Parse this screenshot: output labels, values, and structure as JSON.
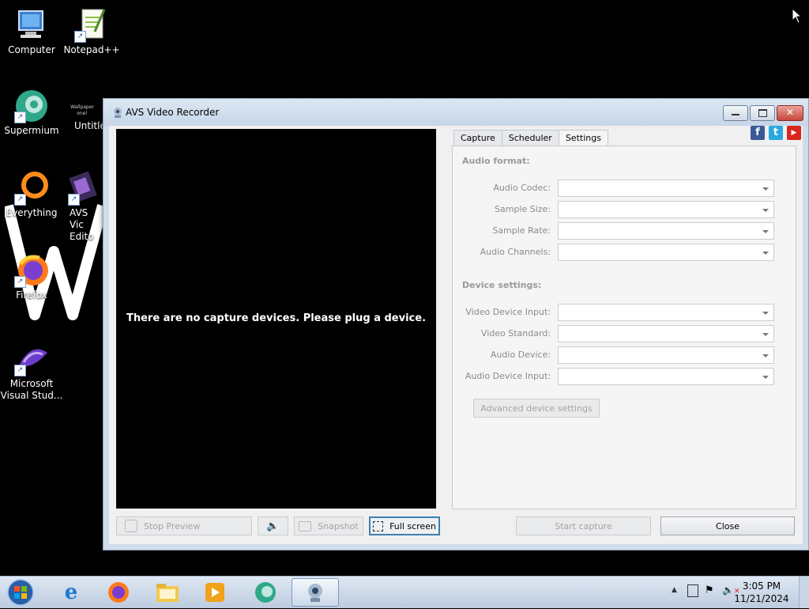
{
  "desktop": {
    "icons": [
      {
        "label": "Computer"
      },
      {
        "label": "Notepad++"
      },
      {
        "label": "Supermium"
      },
      {
        "label": "Untitle"
      },
      {
        "label": "Everything"
      },
      {
        "label": "AVS Vic Edito"
      },
      {
        "label": "Firefox"
      },
      {
        "label": "Microsoft Visual Stud..."
      }
    ],
    "wallpaper_thumb_text": "Wallpaper one!"
  },
  "window": {
    "title": "AVS Video Recorder",
    "preview_message": "There are no capture devices. Please plug a device.",
    "social": [
      "f",
      "t",
      "▶"
    ],
    "tabs": [
      "Capture",
      "Scheduler",
      "Settings"
    ],
    "active_tab": "Settings",
    "settings": {
      "audio_format_heading": "Audio format:",
      "audio_codec": "Audio Codec:",
      "sample_size": "Sample Size:",
      "sample_rate": "Sample Rate:",
      "audio_channels": "Audio Channels:",
      "device_settings_heading": "Device settings:",
      "video_device_input": "Video Device Input:",
      "video_standard": "Video Standard:",
      "audio_device": "Audio Device:",
      "audio_device_input": "Audio Device Input:",
      "advanced_button": "Advanced device settings"
    },
    "bottom": {
      "stop_preview": "Stop Preview",
      "snapshot": "Snapshot",
      "full_screen": "Full screen",
      "start_capture": "Start capture",
      "close": "Close"
    }
  },
  "taskbar": {
    "time": "3:05 PM",
    "date": "11/21/2024"
  },
  "colors": {
    "facebook": "#3b5998",
    "twitter": "#2aa9e0",
    "youtube": "#d8261c"
  }
}
